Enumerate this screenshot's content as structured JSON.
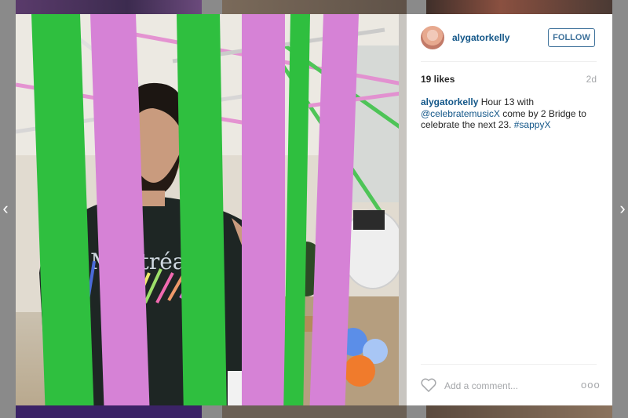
{
  "navigation": {
    "prev_icon": "chevron-left-icon",
    "next_icon": "chevron-right-icon",
    "prev_glyph": "‹",
    "next_glyph": "›"
  },
  "post": {
    "username": "alygatorkelly",
    "follow_label": "FOLLOW",
    "likes": "19 likes",
    "age": "2d",
    "caption": {
      "user": "alygatorkelly",
      "text_1": " Hour 13 with ",
      "mention": "@celebratemusicX",
      "text_2": " come by 2 Bridge to celebrate the next 23. ",
      "hashtag": "#sappyX"
    },
    "photo_text": "Montréal",
    "comment_placeholder": "Add a comment...",
    "more_glyph": "ooo"
  },
  "colors": {
    "link": "#125688",
    "follow_border": "#3f729b",
    "streamer_green": "#2fbf3f",
    "streamer_pink": "#d682d6"
  }
}
